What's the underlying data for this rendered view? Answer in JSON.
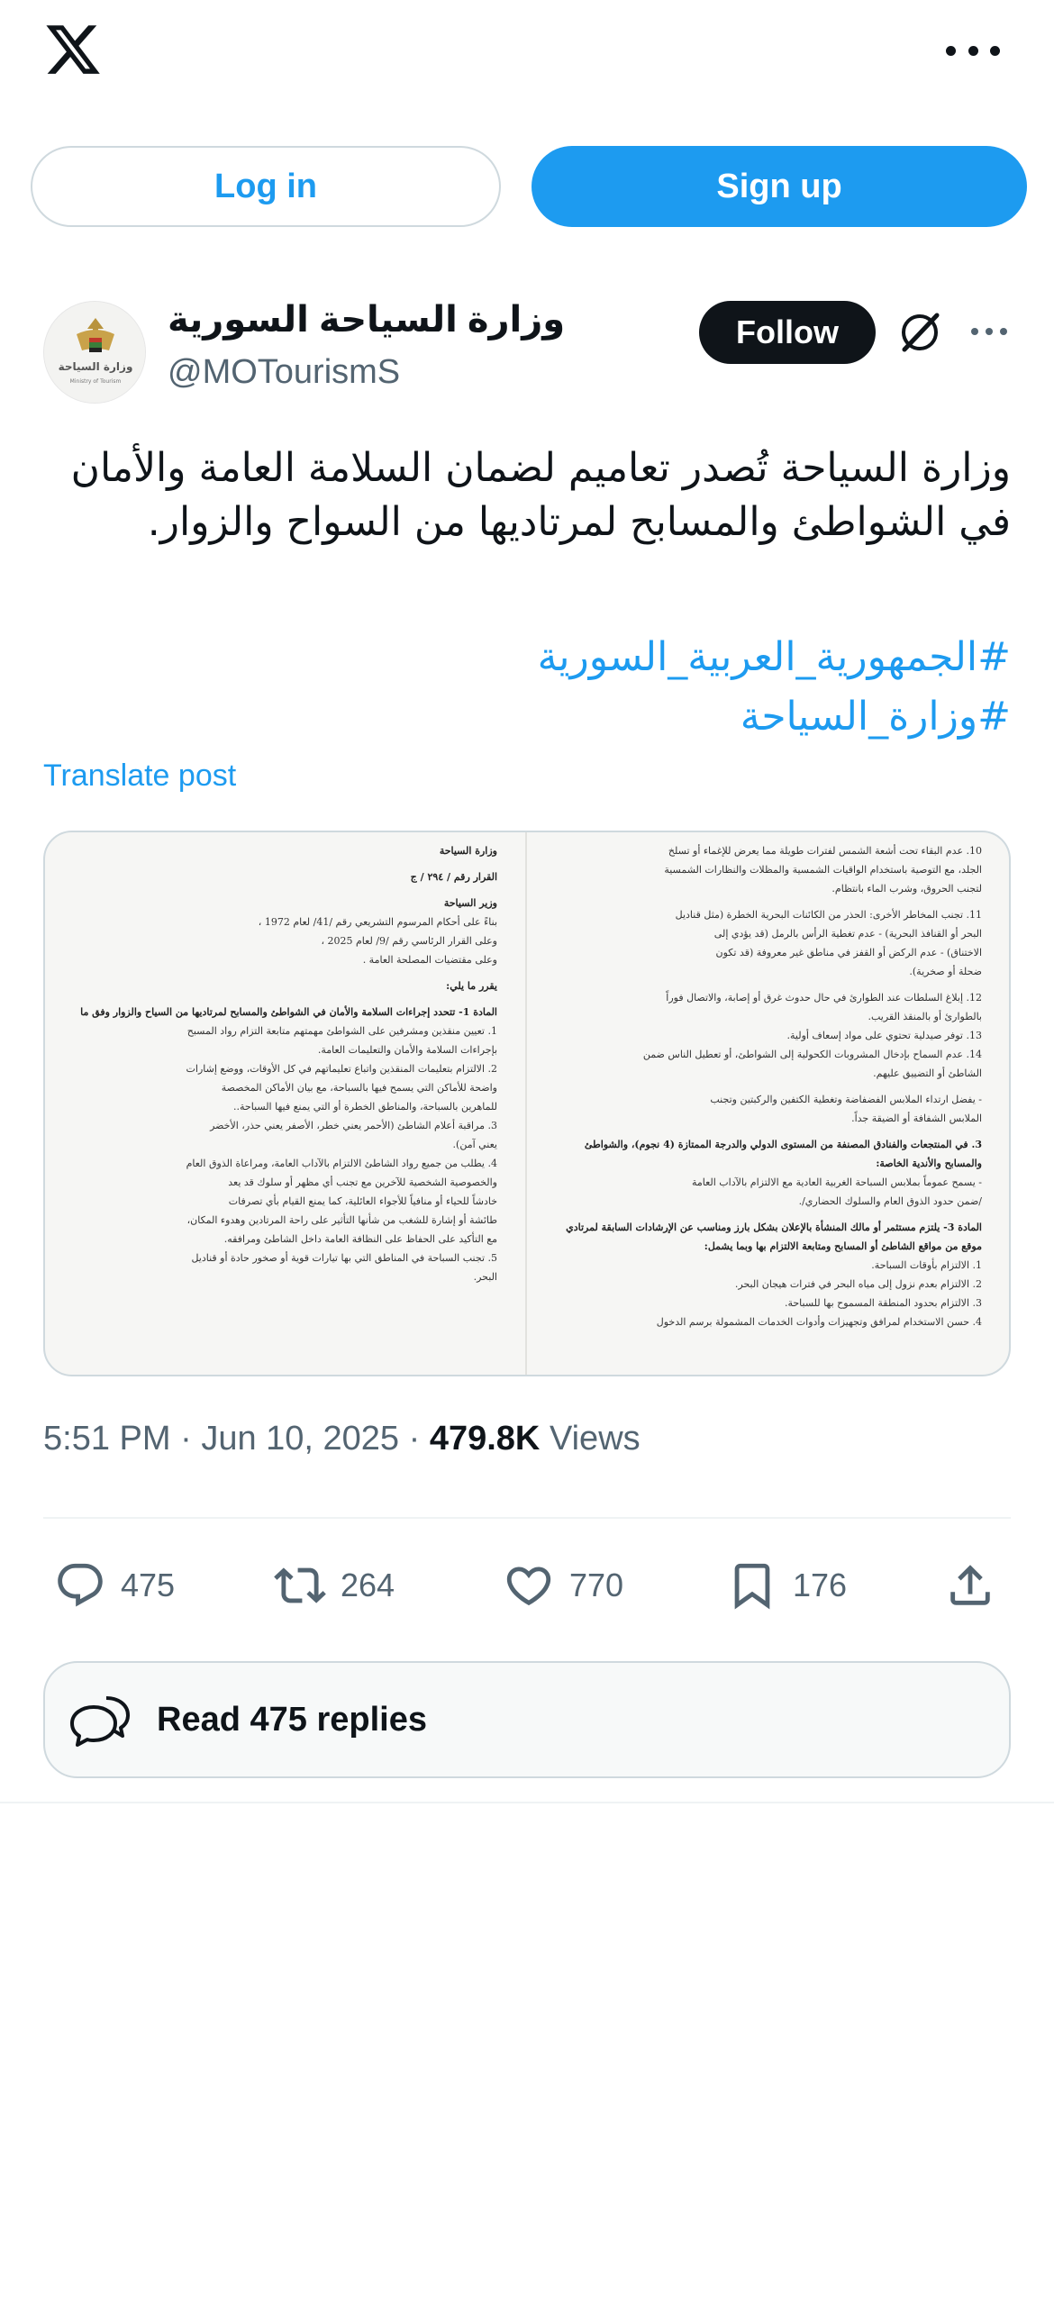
{
  "topbar": {
    "logo_icon": "x-logo-icon",
    "more_icon": "more-horizontal-icon"
  },
  "auth": {
    "login_label": "Log in",
    "signup_label": "Sign up"
  },
  "author": {
    "display_name": "وزارة السياحة السورية",
    "handle": "@MOTourismS",
    "avatar_text": "وزارة السياحة",
    "avatar_subtext": "Ministry of Tourism",
    "follow_label": "Follow"
  },
  "post": {
    "text": "وزارة السياحة تُصدر تعاميم لضمان السلامة العامة والأمان في الشواطئ والمسابح لمرتاديها من السواح والزوار.",
    "hashtags": [
      "#الجمهورية_العربية_السورية",
      "#وزارة_السياحة"
    ],
    "translate_label": "Translate post",
    "time": "5:51 PM",
    "date": "Jun 10, 2025",
    "views_count": "479.8K",
    "views_label": "Views"
  },
  "document": {
    "left_column": [
      "وزارة السياحة",
      "القرار رقم / ٢٩٤ / ج",
      "وزير السياحة",
      "بناءً على أحكام المرسوم التشريعي رقم /41/ لعام 1972 ،",
      "وعلى القرار الرئاسي رقم /9/ لعام 2025 ،",
      "وعلى مقتضيات المصلحة العامة .",
      "يقرر ما يلي:",
      "المادة 1- تتحدد إجراءات السلامة والأمان في الشواطئ والمسابح لمرتاديها من السياح والزوار وفق ما يلي:",
      "1. تعيين منقذين ومشرفين على الشواطئ مهمتهم متابعة التزام رواد المسبح",
      "بإجراءات السلامة والأمان والتعليمات العامة.",
      "2. الالتزام بتعليمات المنقذين واتباع تعليماتهم في كل الأوقات، ووضع إشارات",
      "واضحة للأماكن التي يسمح فيها بالسباحة، مع بيان الأماكن المخصصة",
      "للماهرين بالسباحة، والمناطق الخطرة أو التي يمنع فيها السباحة..",
      "3. مراقبة أعلام الشاطئ (الأحمر يعني خطر، الأصفر يعني حذر، الأخضر",
      "يعني آمن).",
      "4. يطلب من جميع رواد الشاطئ الالتزام بالآداب العامة، ومراعاة الذوق العام",
      "والخصوصية الشخصية للآخرين مع تجنب أي مظهر أو سلوك قد يعد",
      "خادشاً للحياء أو منافياً للأجواء العائلية، كما يمنع القيام بأي تصرفات",
      "طائشة أو إشارة للشغب من شأنها التأثير على راحة المرتادين وهدوء المكان،",
      "مع التأكيد على الحفاظ على النظافة العامة داخل الشاطئ ومرافقه.",
      "5. تجنب السباحة في المناطق التي بها تيارات قوية أو صخور حادة أو قناديل",
      "البحر."
    ],
    "right_column": [
      "10. عدم البقاء تحت أشعة الشمس لفترات طويلة مما يعرض للإغماء أو تسلخ",
      "الجلد، مع التوصية باستخدام الواقيات الشمسية والمظلات والنظارات الشمسية",
      "لتجنب الحروق، وشرب الماء بانتظام.",
      "11. تجنب المخاطر الأخرى: الحذر من الكائنات البحرية الخطرة (مثل قناديل",
      "البحر أو القنافذ البحرية) - عدم تغطية الرأس بالرمل (قد يؤدي إلى",
      "الاختناق) - عدم الركض أو القفز في مناطق غير معروفة (قد تكون",
      "ضحلة أو صخرية).",
      "12. إبلاغ السلطات عند الطوارئ في حال حدوث غرق أو إصابة، والاتصال فوراً",
      "بالطوارئ أو بالمنقذ القريب.",
      "13. توفر صيدلية تحتوي على مواد إسعاف أولية.",
      "14. عدم السماح بإدخال المشروبات الكحولية إلى الشواطئ، أو تعطيل الناس ضمن",
      "الشاطئ أو التضييق عليهم.",
      "- يفضل ارتداء الملابس الفضفاضة وتغطية الكتفين والركبتين وتجنب",
      "الملابس الشفافة أو الضيقة جداً.",
      "3. في المنتجعات والفنادق المصنفة من المستوى الدولي والدرجة الممتازة (4 نجوم)، والشواطئ",
      "والمسابح والأندية الخاصة:",
      "- يسمح عموماً بملابس السباحة الغربية العادية مع الالتزام بالآداب العامة",
      "/ضمن حدود الذوق العام والسلوك الحضاري/.",
      "المادة 3- يلتزم مستثمر أو مالك المنشأة بالإعلان بشكل بارز ومناسب عن الإرشادات السابقة لمرتادي أي",
      "موقع من مواقع الشاطئ أو المسابح ومتابعة الالتزام بها وبما يشمل:",
      "1. الالتزام بأوقات السباحة.",
      "2. الالتزام بعدم نزول إلى مياه البحر في فترات هيجان البحر.",
      "3. الالتزام بحدود المنطقة المسموح بها للسباحة.",
      "4. حسن الاستخدام لمرافق وتجهيزات وأدوات الخدمات المشمولة برسم الدخول"
    ]
  },
  "engagement": {
    "replies": "475",
    "reposts": "264",
    "likes": "770",
    "bookmarks": "176"
  },
  "read_replies_label": "Read 475 replies"
}
